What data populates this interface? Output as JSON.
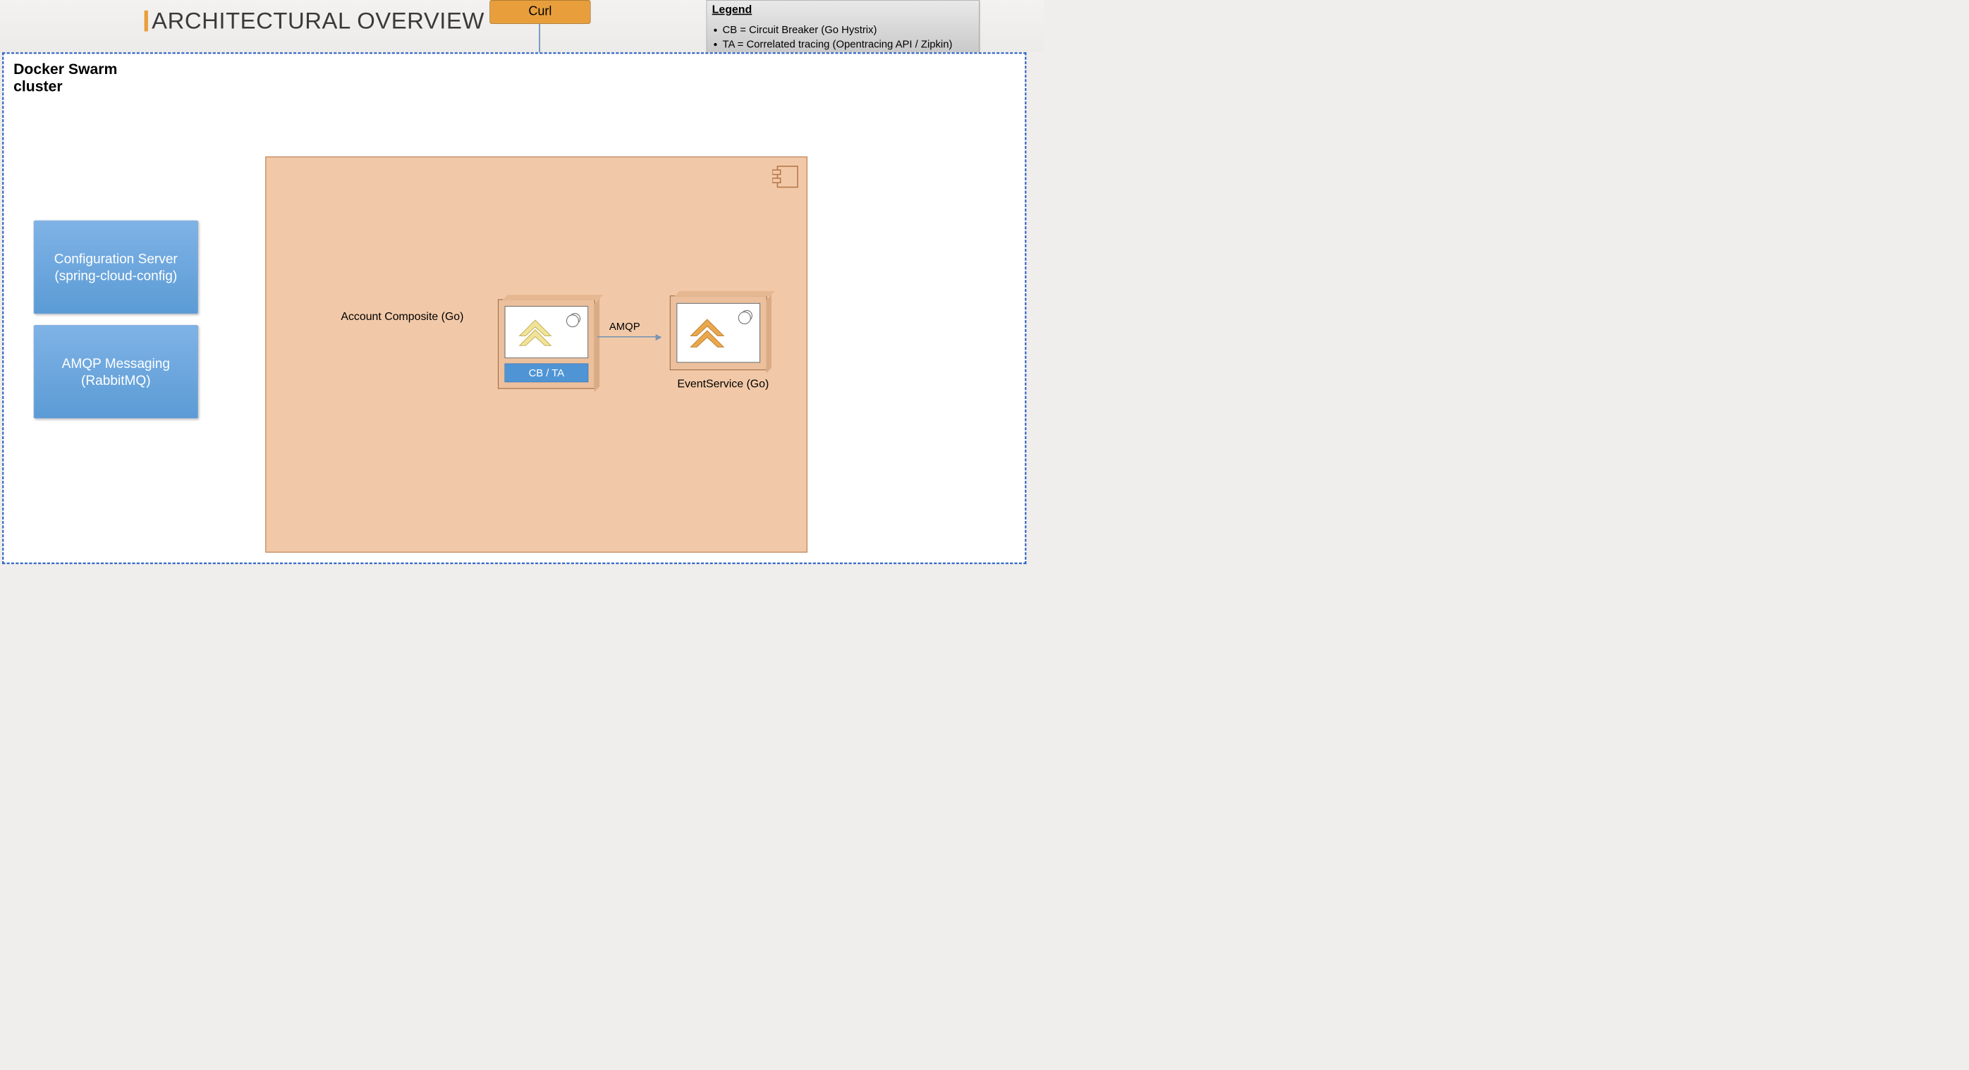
{
  "title": "ARCHITECTURAL OVERVIEW",
  "curl": {
    "label": "Curl"
  },
  "legend": {
    "title": "Legend",
    "items": [
      "CB = Circuit Breaker (Go Hystrix)",
      "TA = Correlated tracing (Opentracing API / Zipkin)"
    ]
  },
  "swarm": {
    "label": "Docker Swarm\ncluster"
  },
  "side_boxes": {
    "config": "Configuration Server\n(spring-cloud-config)",
    "amqp": "AMQP Messaging (RabbitMQ)"
  },
  "services": {
    "account": {
      "label": "Account Composite (Go)",
      "pill": "CB / TA"
    },
    "event": {
      "label": "EventService (Go)"
    }
  },
  "arrows": {
    "amqp_label": "AMQP"
  },
  "colors": {
    "accent_orange": "#e89f3b",
    "swarm_border": "#2c5fbf",
    "salmon": "#f2c9a8",
    "blue_box": "#5b9bd5",
    "pill_blue": "#4f95d6",
    "arrow": "#5b87b8"
  }
}
